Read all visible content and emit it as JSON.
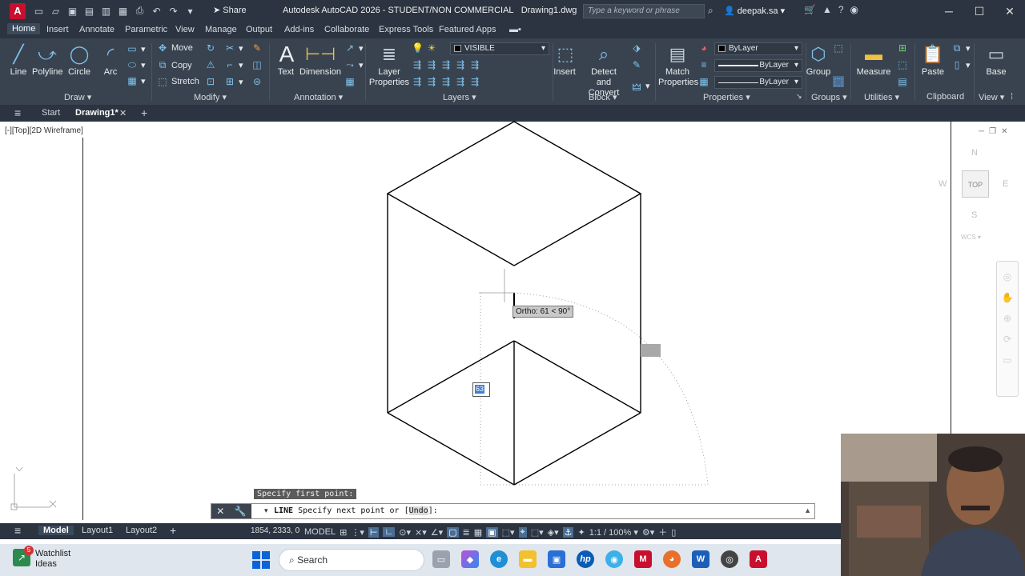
{
  "app": {
    "title": "Autodesk AutoCAD 2026 - STUDENT/NON COMMERCIAL",
    "document": "Drawing1.dwg",
    "search_placeholder": "Type a keyword or phrase",
    "user": "deepak.sa",
    "share_label": "Share",
    "logo_letter": "A"
  },
  "ribbon_tabs": [
    "Home",
    "Insert",
    "Annotate",
    "Parametric",
    "View",
    "Manage",
    "Output",
    "Add-ins",
    "Collaborate",
    "Express Tools",
    "Featured Apps"
  ],
  "ribbon": {
    "draw": {
      "title": "Draw",
      "line": "Line",
      "polyline": "Polyline",
      "circle": "Circle",
      "arc": "Arc"
    },
    "modify": {
      "title": "Modify",
      "move": "Move",
      "copy": "Copy",
      "stretch": "Stretch"
    },
    "annotation": {
      "title": "Annotation",
      "text": "Text",
      "dimension": "Dimension"
    },
    "layers": {
      "title": "Layers",
      "layer_properties": "Layer Properties",
      "current_layer": "VISIBLE"
    },
    "block": {
      "title": "Block",
      "insert": "Insert",
      "detect_convert": "Detect and Convert"
    },
    "properties": {
      "title": "Properties",
      "match": "Match Properties",
      "color": "ByLayer",
      "linetype": "ByLayer",
      "lineweight": "ByLayer"
    },
    "groups": {
      "title": "Groups",
      "group": "Group"
    },
    "utilities": {
      "title": "Utilities",
      "measure": "Measure"
    },
    "clipboard": {
      "title": "Clipboard",
      "paste": "Paste"
    },
    "view": {
      "title": "View",
      "base": "Base"
    }
  },
  "doc_tabs": {
    "start": "Start",
    "drawing": "Drawing1*"
  },
  "viewport": {
    "label": "[-][Top][2D Wireframe]",
    "ortho_tooltip": "Ortho: 61 < 90°",
    "dynamic_input": "63",
    "viewcube": {
      "top": "TOP",
      "n": "N",
      "s": "S",
      "w": "W",
      "e": "E",
      "wcs": "WCS"
    }
  },
  "command": {
    "history": "Specify first point:",
    "command_name": "LINE",
    "prompt": "Specify next point or",
    "option": "Undo",
    "suffix": "]:"
  },
  "layout_tabs": [
    "Model",
    "Layout1",
    "Layout2"
  ],
  "status": {
    "coords": "1854, 2333, 0",
    "space": "MODEL",
    "scale": "1:1 / 100%"
  },
  "taskbar": {
    "weather_title": "Watchlist",
    "weather_sub": "Ideas",
    "badge": "5",
    "search": "Search"
  },
  "colors": {
    "titlebar": "#2b3440",
    "ribbon": "#39434f",
    "accent": "#7fc3ee",
    "autocad_red": "#c8102e"
  }
}
